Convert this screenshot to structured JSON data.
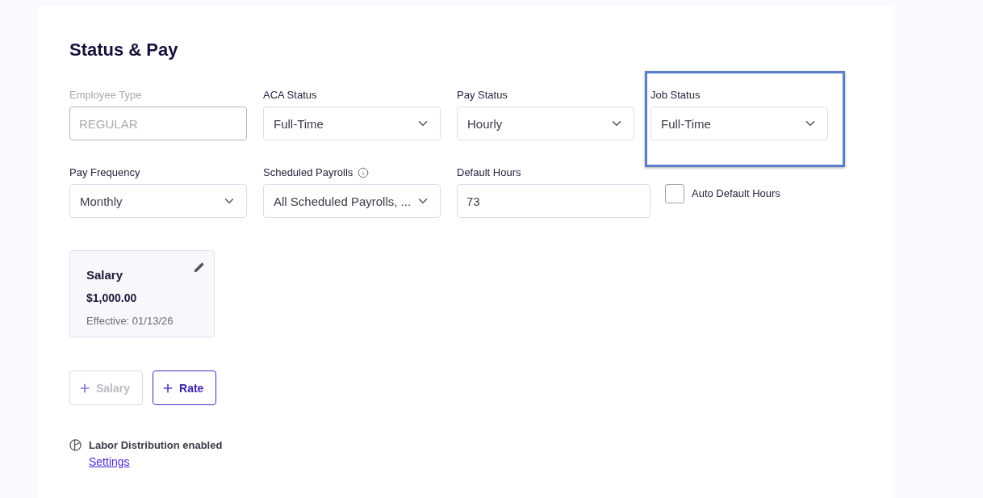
{
  "section": {
    "title": "Status & Pay"
  },
  "field_rows": [
    {
      "fields": [
        {
          "kind": "text",
          "label": "Employee Type",
          "value": "REGULAR",
          "disabled": true,
          "highlighted": false
        },
        {
          "kind": "select",
          "label": "ACA Status",
          "value": "Full-Time",
          "disabled": false,
          "highlighted": false
        },
        {
          "kind": "select",
          "label": "Pay Status",
          "value": "Hourly",
          "disabled": false,
          "highlighted": false
        },
        {
          "kind": "select",
          "label": "Job Status",
          "value": "Full-Time",
          "disabled": false,
          "highlighted": true
        }
      ]
    },
    {
      "fields": [
        {
          "kind": "select",
          "label": "Pay Frequency",
          "value": "Monthly",
          "disabled": false,
          "highlighted": false
        },
        {
          "kind": "select",
          "label": "Scheduled Payrolls",
          "info": true,
          "value": "All Scheduled Payrolls, ...",
          "disabled": false,
          "highlighted": false
        },
        {
          "kind": "number",
          "label": "Default Hours",
          "value": "73",
          "disabled": false,
          "highlighted": false
        },
        {
          "kind": "checkbox",
          "label": "Auto Default Hours",
          "checked": false
        }
      ]
    }
  ],
  "compensations": [
    {
      "title": "Salary",
      "amount": "$1,000.00",
      "effective": "Effective: 01/13/26"
    }
  ],
  "add_buttons": [
    {
      "label": "Salary",
      "disabled": true
    },
    {
      "label": "Rate",
      "disabled": false
    }
  ],
  "labor_distribution": {
    "text": "Labor Distribution enabled",
    "link": "Settings"
  }
}
